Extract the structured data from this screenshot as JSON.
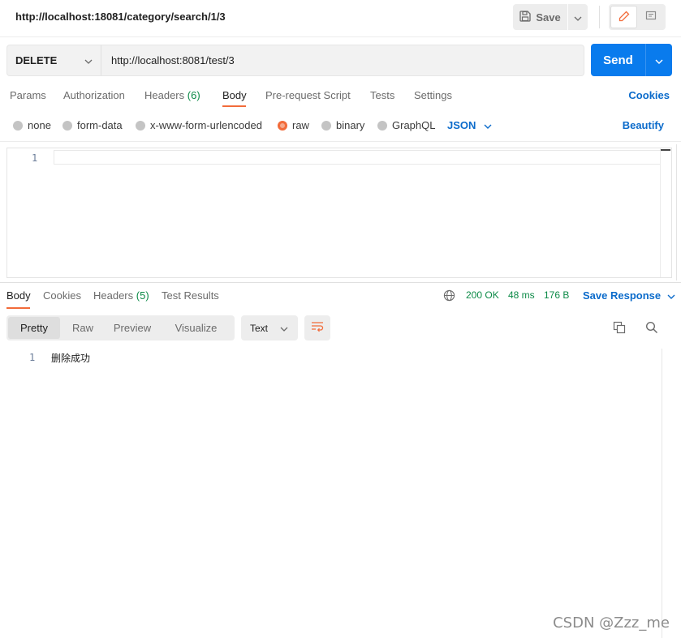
{
  "request": {
    "name": "http://localhost:18081/category/search/1/3",
    "save_label": "Save",
    "method": "DELETE",
    "url": "http://localhost:8081/test/3",
    "send_label": "Send"
  },
  "request_tabs": {
    "params": "Params",
    "authorization": "Authorization",
    "headers": "Headers",
    "headers_count": "(6)",
    "body": "Body",
    "prerequest": "Pre-request Script",
    "tests": "Tests",
    "settings": "Settings",
    "cookies": "Cookies",
    "active": "Body"
  },
  "body_types": {
    "none": "none",
    "form_data": "form-data",
    "urlencoded": "x-www-form-urlencoded",
    "raw": "raw",
    "binary": "binary",
    "graphql": "GraphQL",
    "selected": "raw",
    "format": "JSON",
    "beautify": "Beautify"
  },
  "editor": {
    "line_number": "1",
    "content": ""
  },
  "response_tabs": {
    "body": "Body",
    "cookies": "Cookies",
    "headers": "Headers",
    "headers_count": "(5)",
    "test_results": "Test Results",
    "active": "Body"
  },
  "response_status": {
    "status": "200 OK",
    "time": "48 ms",
    "size": "176 B",
    "save_response": "Save Response"
  },
  "response_view": {
    "modes": [
      "Pretty",
      "Raw",
      "Preview",
      "Visualize"
    ],
    "active": "Pretty",
    "format": "Text"
  },
  "response_body": {
    "line_number": "1",
    "text": "删除成功"
  },
  "watermark": "CSDN @Zzz_me",
  "colors": {
    "accent": "#f26b3a",
    "primary": "#097bed",
    "link": "#0b6bcb",
    "success": "#0c8a47"
  },
  "icons": [
    "save-icon",
    "chevron-down-icon",
    "pencil-icon",
    "comment-icon",
    "globe-icon",
    "wrap-lines-icon",
    "copy-icon",
    "search-icon"
  ]
}
